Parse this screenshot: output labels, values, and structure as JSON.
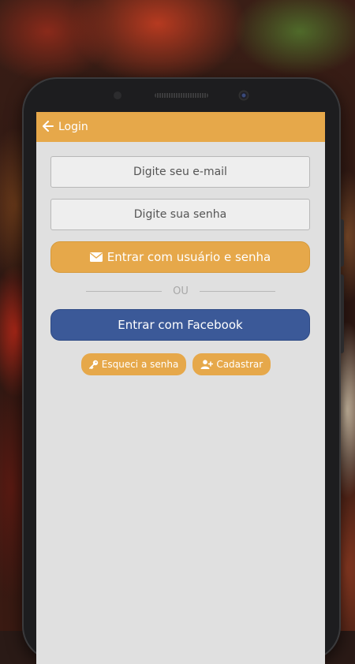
{
  "appbar": {
    "back_icon": "arrow-left-icon",
    "title": "Login"
  },
  "form": {
    "email_placeholder": "Digite seu e-mail",
    "password_placeholder": "Digite sua senha",
    "login_button_label": "Entrar com usuário e senha",
    "login_button_icon": "envelope-icon",
    "divider_text": "OU",
    "facebook_button_label": "Entrar com Facebook"
  },
  "links": {
    "forgot_label": "Esqueci a senha",
    "forgot_icon": "key-icon",
    "register_label": "Cadastrar",
    "register_icon": "user-plus-icon"
  },
  "colors": {
    "accent": "#e6a84a",
    "facebook": "#3b5998",
    "screen_bg": "#e0e0e0"
  }
}
